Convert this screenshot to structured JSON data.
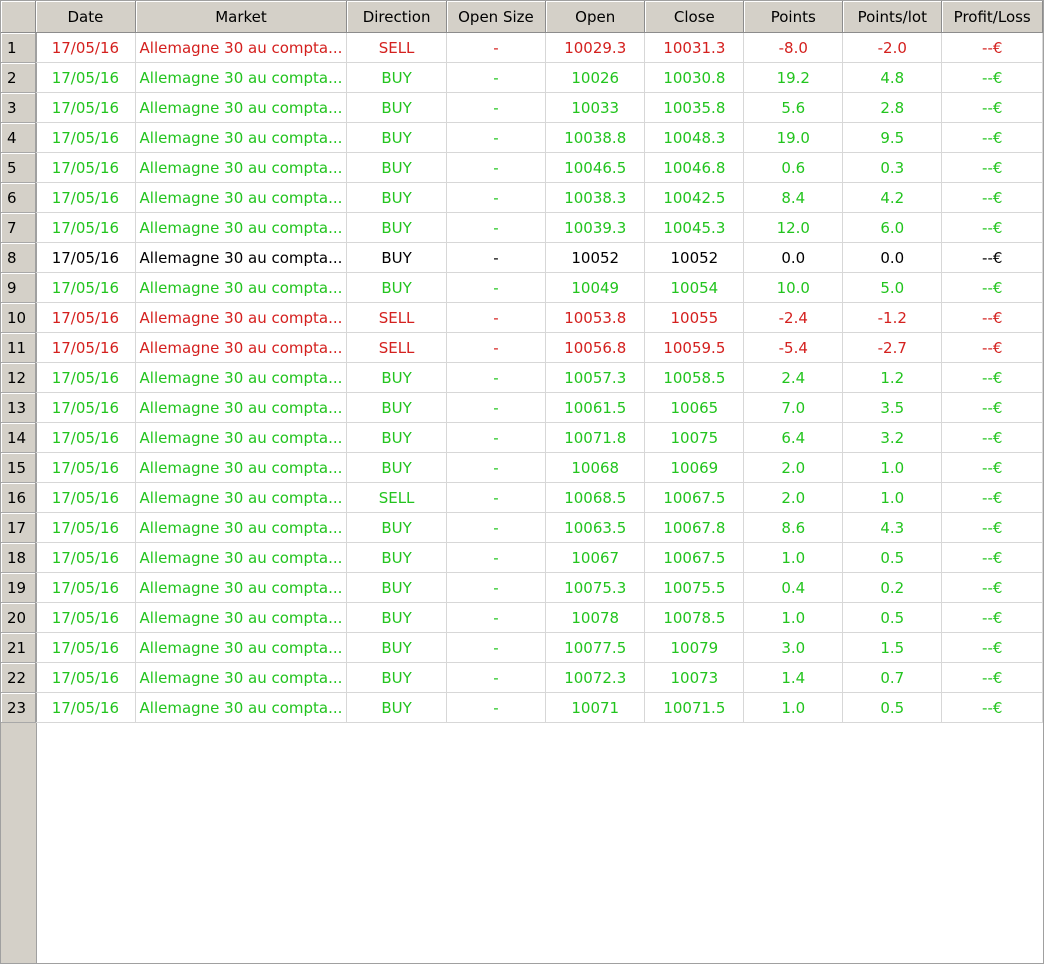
{
  "columns": [
    "Date",
    "Market",
    "Direction",
    "Open Size",
    "Open",
    "Close",
    "Points",
    "Points/lot",
    "Profit/Loss"
  ],
  "colors": {
    "loss": "#d4201e",
    "profit": "#22c41e",
    "neutral": "#000000",
    "header_bg": "#d4d0c8"
  },
  "rows": [
    {
      "n": "1",
      "status": "red",
      "date": "17/05/16",
      "market": "Allemagne 30 au compta...",
      "direction": "SELL",
      "size": "-",
      "open": "10029.3",
      "close": "10031.3",
      "points": "-8.0",
      "points_lot": "-2.0",
      "pl": "--€"
    },
    {
      "n": "2",
      "status": "green",
      "date": "17/05/16",
      "market": "Allemagne 30 au compta...",
      "direction": "BUY",
      "size": "-",
      "open": "10026",
      "close": "10030.8",
      "points": "19.2",
      "points_lot": "4.8",
      "pl": "--€"
    },
    {
      "n": "3",
      "status": "green",
      "date": "17/05/16",
      "market": "Allemagne 30 au compta...",
      "direction": "BUY",
      "size": "-",
      "open": "10033",
      "close": "10035.8",
      "points": "5.6",
      "points_lot": "2.8",
      "pl": "--€"
    },
    {
      "n": "4",
      "status": "green",
      "date": "17/05/16",
      "market": "Allemagne 30 au compta...",
      "direction": "BUY",
      "size": "-",
      "open": "10038.8",
      "close": "10048.3",
      "points": "19.0",
      "points_lot": "9.5",
      "pl": "--€"
    },
    {
      "n": "5",
      "status": "green",
      "date": "17/05/16",
      "market": "Allemagne 30 au compta...",
      "direction": "BUY",
      "size": "-",
      "open": "10046.5",
      "close": "10046.8",
      "points": "0.6",
      "points_lot": "0.3",
      "pl": "--€"
    },
    {
      "n": "6",
      "status": "green",
      "date": "17/05/16",
      "market": "Allemagne 30 au compta...",
      "direction": "BUY",
      "size": "-",
      "open": "10038.3",
      "close": "10042.5",
      "points": "8.4",
      "points_lot": "4.2",
      "pl": "--€"
    },
    {
      "n": "7",
      "status": "green",
      "date": "17/05/16",
      "market": "Allemagne 30 au compta...",
      "direction": "BUY",
      "size": "-",
      "open": "10039.3",
      "close": "10045.3",
      "points": "12.0",
      "points_lot": "6.0",
      "pl": "--€"
    },
    {
      "n": "8",
      "status": "black",
      "date": "17/05/16",
      "market": "Allemagne 30 au compta...",
      "direction": "BUY",
      "size": "-",
      "open": "10052",
      "close": "10052",
      "points": "0.0",
      "points_lot": "0.0",
      "pl": "--€"
    },
    {
      "n": "9",
      "status": "green",
      "date": "17/05/16",
      "market": "Allemagne 30 au compta...",
      "direction": "BUY",
      "size": "-",
      "open": "10049",
      "close": "10054",
      "points": "10.0",
      "points_lot": "5.0",
      "pl": "--€"
    },
    {
      "n": "10",
      "status": "red",
      "date": "17/05/16",
      "market": "Allemagne 30 au compta...",
      "direction": "SELL",
      "size": "-",
      "open": "10053.8",
      "close": "10055",
      "points": "-2.4",
      "points_lot": "-1.2",
      "pl": "--€"
    },
    {
      "n": "11",
      "status": "red",
      "date": "17/05/16",
      "market": "Allemagne 30 au compta...",
      "direction": "SELL",
      "size": "-",
      "open": "10056.8",
      "close": "10059.5",
      "points": "-5.4",
      "points_lot": "-2.7",
      "pl": "--€"
    },
    {
      "n": "12",
      "status": "green",
      "date": "17/05/16",
      "market": "Allemagne 30 au compta...",
      "direction": "BUY",
      "size": "-",
      "open": "10057.3",
      "close": "10058.5",
      "points": "2.4",
      "points_lot": "1.2",
      "pl": "--€"
    },
    {
      "n": "13",
      "status": "green",
      "date": "17/05/16",
      "market": "Allemagne 30 au compta...",
      "direction": "BUY",
      "size": "-",
      "open": "10061.5",
      "close": "10065",
      "points": "7.0",
      "points_lot": "3.5",
      "pl": "--€"
    },
    {
      "n": "14",
      "status": "green",
      "date": "17/05/16",
      "market": "Allemagne 30 au compta...",
      "direction": "BUY",
      "size": "-",
      "open": "10071.8",
      "close": "10075",
      "points": "6.4",
      "points_lot": "3.2",
      "pl": "--€"
    },
    {
      "n": "15",
      "status": "green",
      "date": "17/05/16",
      "market": "Allemagne 30 au compta...",
      "direction": "BUY",
      "size": "-",
      "open": "10068",
      "close": "10069",
      "points": "2.0",
      "points_lot": "1.0",
      "pl": "--€"
    },
    {
      "n": "16",
      "status": "green",
      "date": "17/05/16",
      "market": "Allemagne 30 au compta...",
      "direction": "SELL",
      "size": "-",
      "open": "10068.5",
      "close": "10067.5",
      "points": "2.0",
      "points_lot": "1.0",
      "pl": "--€"
    },
    {
      "n": "17",
      "status": "green",
      "date": "17/05/16",
      "market": "Allemagne 30 au compta...",
      "direction": "BUY",
      "size": "-",
      "open": "10063.5",
      "close": "10067.8",
      "points": "8.6",
      "points_lot": "4.3",
      "pl": "--€"
    },
    {
      "n": "18",
      "status": "green",
      "date": "17/05/16",
      "market": "Allemagne 30 au compta...",
      "direction": "BUY",
      "size": "-",
      "open": "10067",
      "close": "10067.5",
      "points": "1.0",
      "points_lot": "0.5",
      "pl": "--€"
    },
    {
      "n": "19",
      "status": "green",
      "date": "17/05/16",
      "market": "Allemagne 30 au compta...",
      "direction": "BUY",
      "size": "-",
      "open": "10075.3",
      "close": "10075.5",
      "points": "0.4",
      "points_lot": "0.2",
      "pl": "--€"
    },
    {
      "n": "20",
      "status": "green",
      "date": "17/05/16",
      "market": "Allemagne 30 au compta...",
      "direction": "BUY",
      "size": "-",
      "open": "10078",
      "close": "10078.5",
      "points": "1.0",
      "points_lot": "0.5",
      "pl": "--€"
    },
    {
      "n": "21",
      "status": "green",
      "date": "17/05/16",
      "market": "Allemagne 30 au compta...",
      "direction": "BUY",
      "size": "-",
      "open": "10077.5",
      "close": "10079",
      "points": "3.0",
      "points_lot": "1.5",
      "pl": "--€"
    },
    {
      "n": "22",
      "status": "green",
      "date": "17/05/16",
      "market": "Allemagne 30 au compta...",
      "direction": "BUY",
      "size": "-",
      "open": "10072.3",
      "close": "10073",
      "points": "1.4",
      "points_lot": "0.7",
      "pl": "--€"
    },
    {
      "n": "23",
      "status": "green",
      "date": "17/05/16",
      "market": "Allemagne 30 au compta...",
      "direction": "BUY",
      "size": "-",
      "open": "10071",
      "close": "10071.5",
      "points": "1.0",
      "points_lot": "0.5",
      "pl": "--€"
    }
  ]
}
